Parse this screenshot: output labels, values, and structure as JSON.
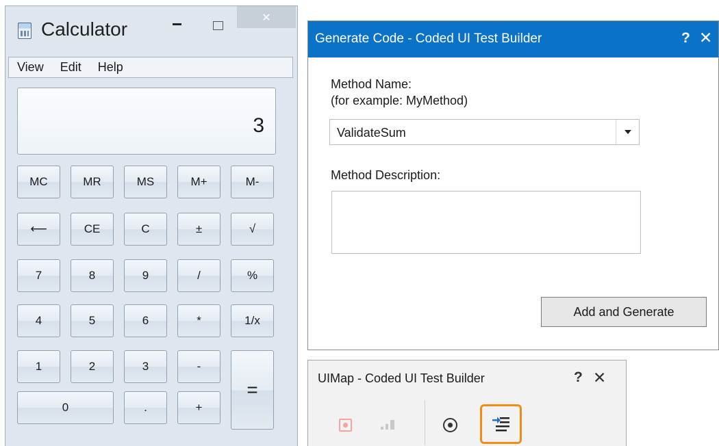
{
  "calculator": {
    "title": "Calculator",
    "menu": [
      "View",
      "Edit",
      "Help"
    ],
    "display": "3",
    "keys": [
      {
        "label": "MC",
        "name": "mc-key"
      },
      {
        "label": "MR",
        "name": "mr-key"
      },
      {
        "label": "MS",
        "name": "ms-key"
      },
      {
        "label": "M+",
        "name": "m-plus-key"
      },
      {
        "label": "M-",
        "name": "m-minus-key"
      },
      {
        "label": "⟵",
        "name": "backspace-key"
      },
      {
        "label": "CE",
        "name": "ce-key"
      },
      {
        "label": "C",
        "name": "c-key"
      },
      {
        "label": "±",
        "name": "plus-minus-key"
      },
      {
        "label": "√",
        "name": "sqrt-key"
      },
      {
        "label": "7",
        "name": "digit-7-key"
      },
      {
        "label": "8",
        "name": "digit-8-key"
      },
      {
        "label": "9",
        "name": "digit-9-key"
      },
      {
        "label": "/",
        "name": "divide-key"
      },
      {
        "label": "%",
        "name": "percent-key"
      },
      {
        "label": "4",
        "name": "digit-4-key"
      },
      {
        "label": "5",
        "name": "digit-5-key"
      },
      {
        "label": "6",
        "name": "digit-6-key"
      },
      {
        "label": "*",
        "name": "multiply-key"
      },
      {
        "label": "1/x",
        "name": "reciprocal-key"
      },
      {
        "label": "1",
        "name": "digit-1-key"
      },
      {
        "label": "2",
        "name": "digit-2-key"
      },
      {
        "label": "3",
        "name": "digit-3-key"
      },
      {
        "label": "-",
        "name": "subtract-key"
      },
      {
        "label": "=",
        "name": "equals-key"
      },
      {
        "label": "0",
        "name": "digit-0-key"
      },
      {
        "label": ".",
        "name": "decimal-key"
      },
      {
        "label": "+",
        "name": "add-key"
      }
    ]
  },
  "generate_dialog": {
    "title": "Generate Code - Coded UI Test Builder",
    "help": "?",
    "close": "✕",
    "method_name_label": "Method Name:",
    "method_name_hint": "(for example: MyMethod)",
    "method_name_value": "ValidateSum",
    "method_description_label": "Method Description:",
    "method_description_value": "",
    "button_label": "Add and Generate"
  },
  "uimap_toolbar": {
    "title": "UIMap - Coded UI Test Builder",
    "help": "?",
    "close": "✕",
    "tools": [
      "record-icon",
      "show-recorded-steps-icon",
      "add-assertions-icon",
      "generate-code-icon"
    ],
    "highlight_color": "#f28c13"
  },
  "colors": {
    "dialog_title_bar": "#0b73c7",
    "calculator_chrome": "#dfe6ee"
  }
}
